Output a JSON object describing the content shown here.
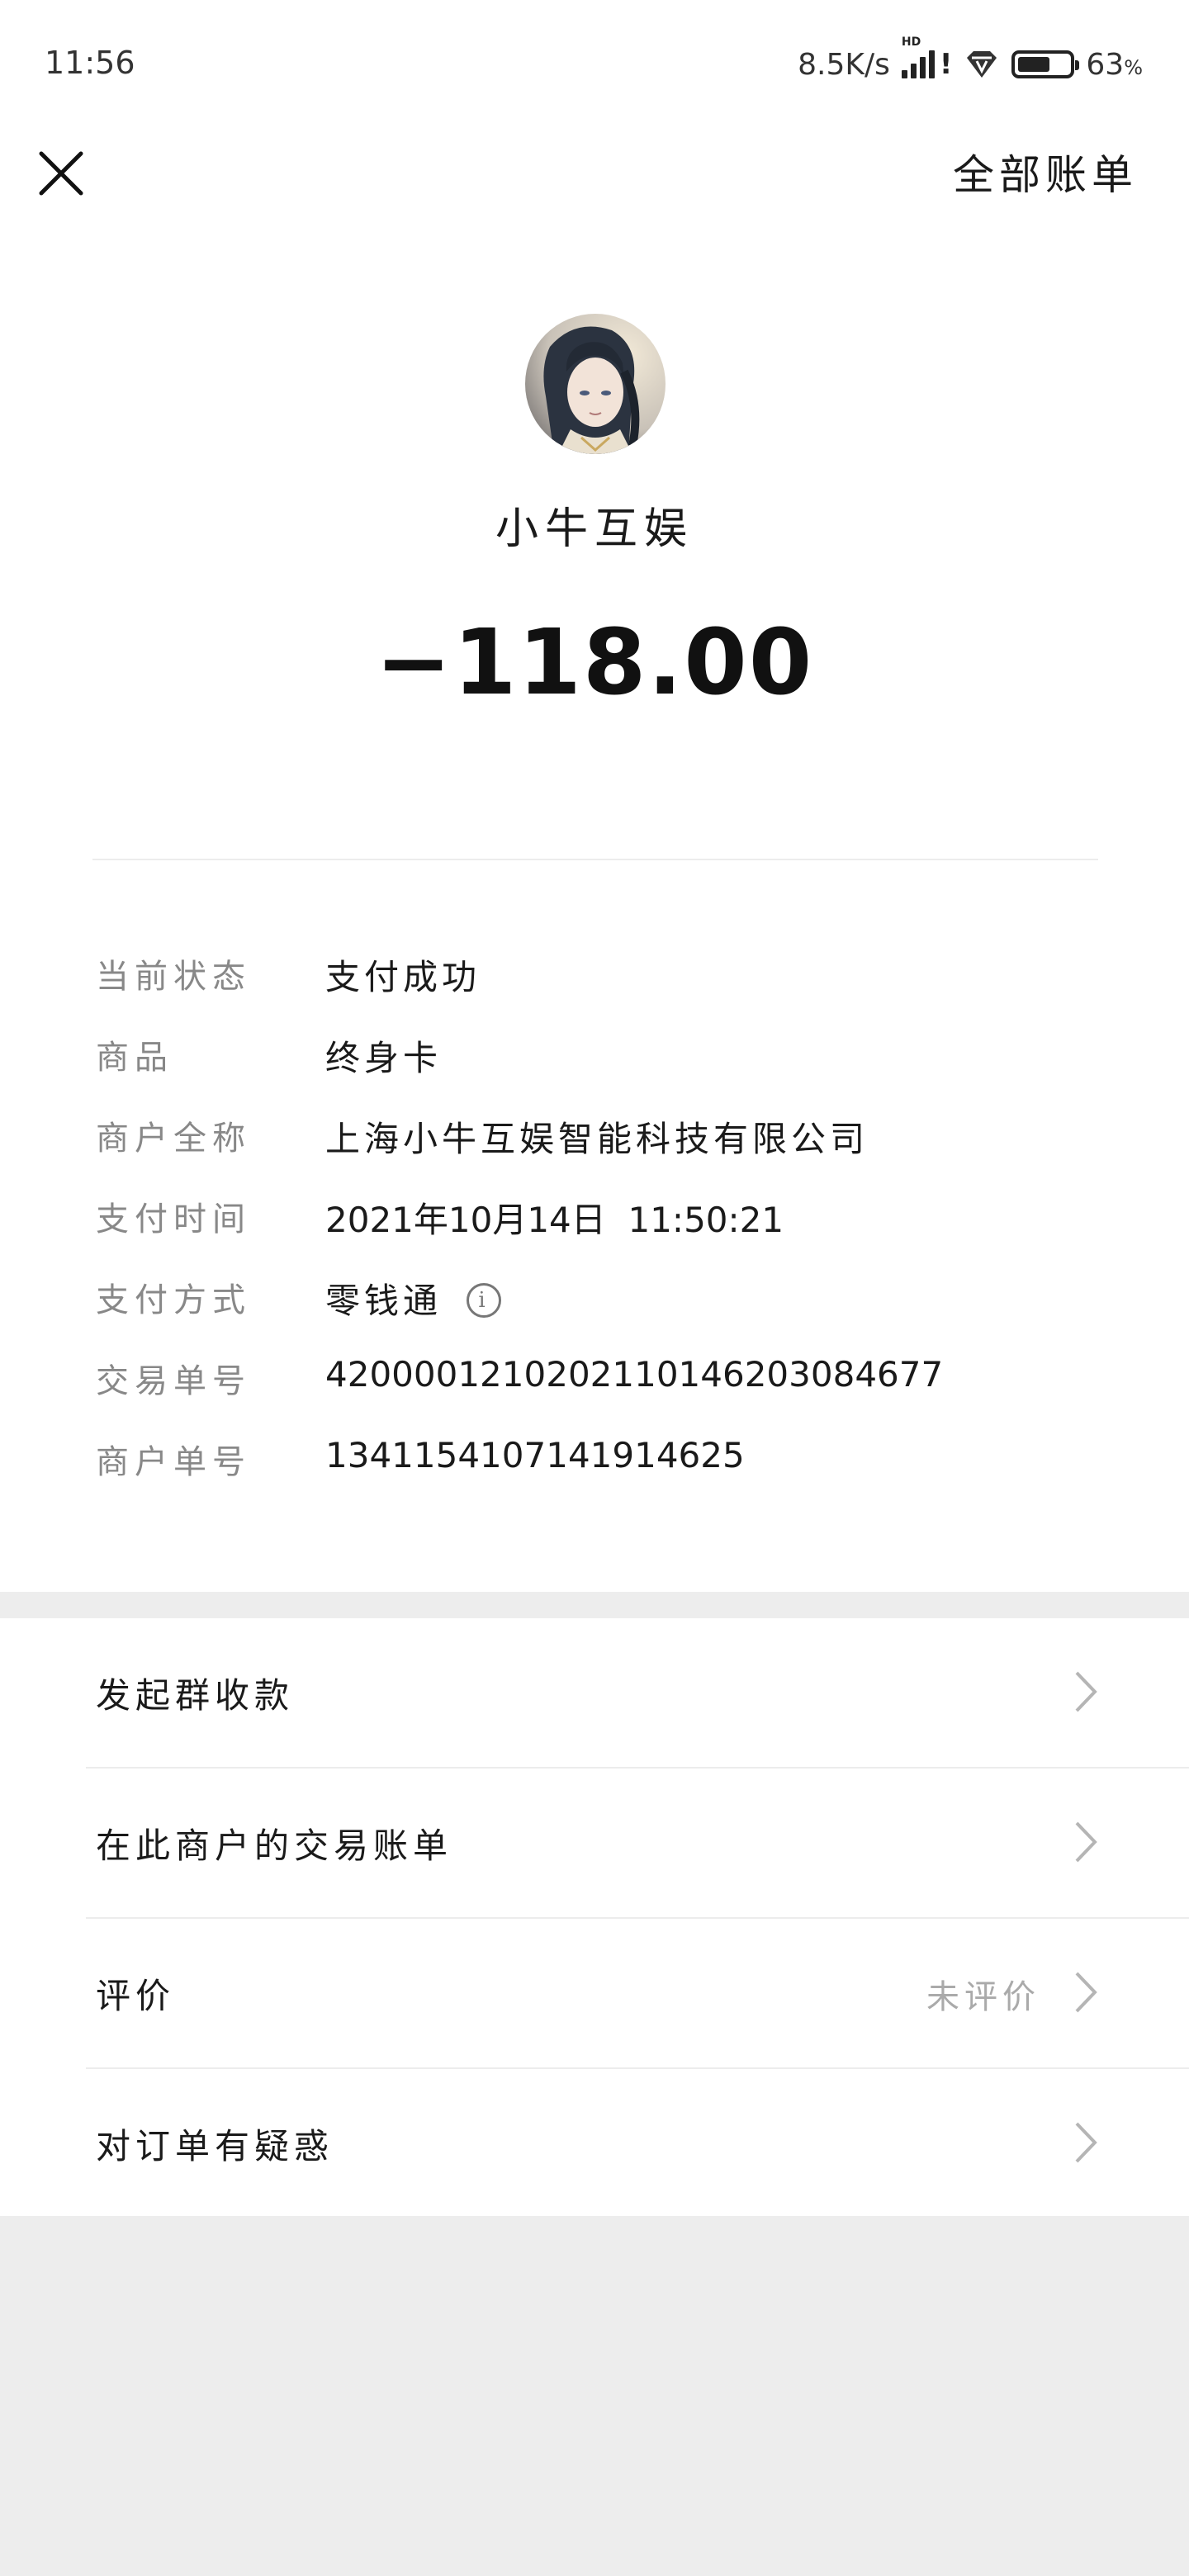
{
  "status_bar": {
    "time": "11:56",
    "network_speed": "8.5K/s",
    "signal_badge": "HD",
    "battery_percent": "63",
    "battery_unit": "%"
  },
  "nav": {
    "right_label": "全部账单"
  },
  "transaction": {
    "merchant_short_name": "小牛互娱",
    "amount": "−118.00"
  },
  "details": [
    {
      "label": "当前状态",
      "value": "支付成功"
    },
    {
      "label": "商品",
      "value": "终身卡"
    },
    {
      "label": "商户全称",
      "value": "上海小牛互娱智能科技有限公司"
    },
    {
      "label": "支付时间",
      "value": "2021年10月14日  11:50:21"
    },
    {
      "label": "支付方式",
      "value": "零钱通"
    },
    {
      "label": "交易单号",
      "value": "4200001210202110146203084677"
    },
    {
      "label": "商户单号",
      "value": "1341154107141914625"
    }
  ],
  "menu": [
    {
      "label": "发起群收款",
      "aux": ""
    },
    {
      "label": "在此商户的交易账单",
      "aux": ""
    },
    {
      "label": "评价",
      "aux": "未评价"
    },
    {
      "label": "对订单有疑惑",
      "aux": ""
    }
  ],
  "icons": {
    "close": "close-icon",
    "info": "info-icon",
    "chevron": "chevron-right-icon",
    "wifi": "diamond-wifi-icon"
  },
  "colors": {
    "page_background": "#ededed",
    "card_background": "#ffffff",
    "label_gray": "#888888",
    "text_dark": "#1a1a1a"
  }
}
